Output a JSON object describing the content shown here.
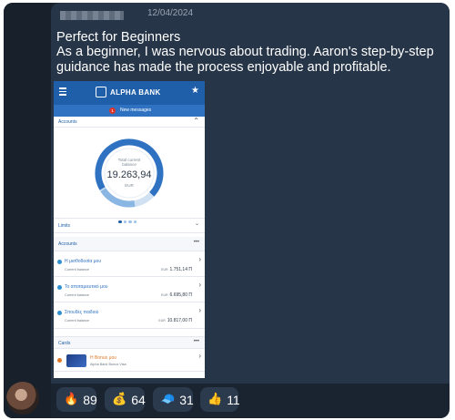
{
  "message": {
    "date": "12/04/2024",
    "title": "Perfect for Beginners",
    "body": "As a beginner, I was nervous about trading. Aaron's step-by-step guidance has made the process enjoyable and profitable."
  },
  "phone": {
    "brand": "ALPHA BANK",
    "new_messages_count": "1",
    "new_messages": "New messages",
    "accounts_header": "Accounts",
    "donut": {
      "label_line1": "Total current",
      "label_line2": "balance",
      "value": "19.263,94",
      "currency": "EUR"
    },
    "limits": "Limits",
    "accounts_section": "Accounts",
    "accounts": [
      {
        "name": "Η μισθοδοσία μου",
        "sub": "Current balance",
        "cur": "EUR",
        "amount": "1.751,14 Π"
      },
      {
        "name": "Το αποταμιευτικό μου",
        "sub": "Current balance",
        "cur": "EUR",
        "amount": "6.695,80 Π"
      },
      {
        "name": "Σπουδές παιδιού",
        "sub": "Current balance",
        "cur": "EUR",
        "amount": "10.817,00 Π"
      }
    ],
    "cards_section": "Cards",
    "card": {
      "name": "Η Bonus μου",
      "sub": "Alpha Bank Bonus Visa"
    }
  },
  "reactions": [
    {
      "icon": "fire-icon",
      "emoji": "🔥",
      "count": "89"
    },
    {
      "icon": "money-bag-icon",
      "emoji": "💰",
      "count": "64"
    },
    {
      "icon": "cap-icon",
      "emoji": "🧢",
      "count": "31"
    },
    {
      "icon": "thumbs-up-icon",
      "emoji": "👍",
      "count": "11"
    }
  ],
  "colors": {
    "background": "#1a2330",
    "bubble": "#263547",
    "bank_blue": "#1f5ea8"
  }
}
